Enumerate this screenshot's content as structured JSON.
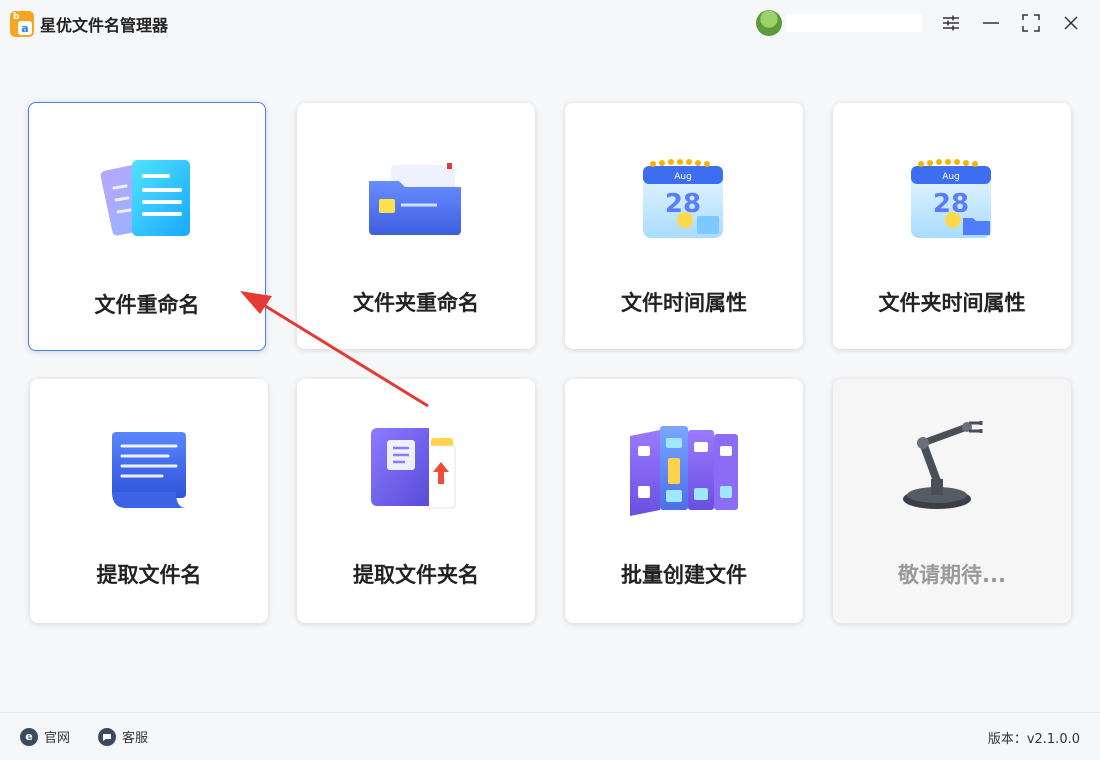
{
  "app": {
    "title": "星优文件名管理器",
    "logo_letters": "b",
    "logo_inner": "a"
  },
  "window_controls": {
    "settings_icon": "sliders-icon",
    "minimize_icon": "minimize-icon",
    "maximize_icon": "maximize-icon",
    "close_icon": "close-icon"
  },
  "tiles": [
    {
      "label": "文件重命名",
      "icon": "document-stack-icon",
      "selected": true
    },
    {
      "label": "文件夹重命名",
      "icon": "folder-icon"
    },
    {
      "label": "文件时间属性",
      "icon": "calendar-icon"
    },
    {
      "label": "文件夹时间属性",
      "icon": "calendar-folder-icon"
    },
    {
      "label": "提取文件名",
      "icon": "scroll-list-icon"
    },
    {
      "label": "提取文件夹名",
      "icon": "book-export-icon"
    },
    {
      "label": "批量创建文件",
      "icon": "binders-icon"
    },
    {
      "label": "敬请期待...",
      "icon": "robot-arm-icon",
      "disabled": true
    }
  ],
  "calendar_month": "Aug",
  "calendar_day": "28",
  "footer": {
    "website_label": "官网",
    "website_icon_letter": "e",
    "support_label": "客服",
    "version": "版本：v2.1.0.0"
  },
  "colors": {
    "accent": "#4a7fe6",
    "annotation_arrow": "#e53935",
    "logo": "#f6a623"
  }
}
